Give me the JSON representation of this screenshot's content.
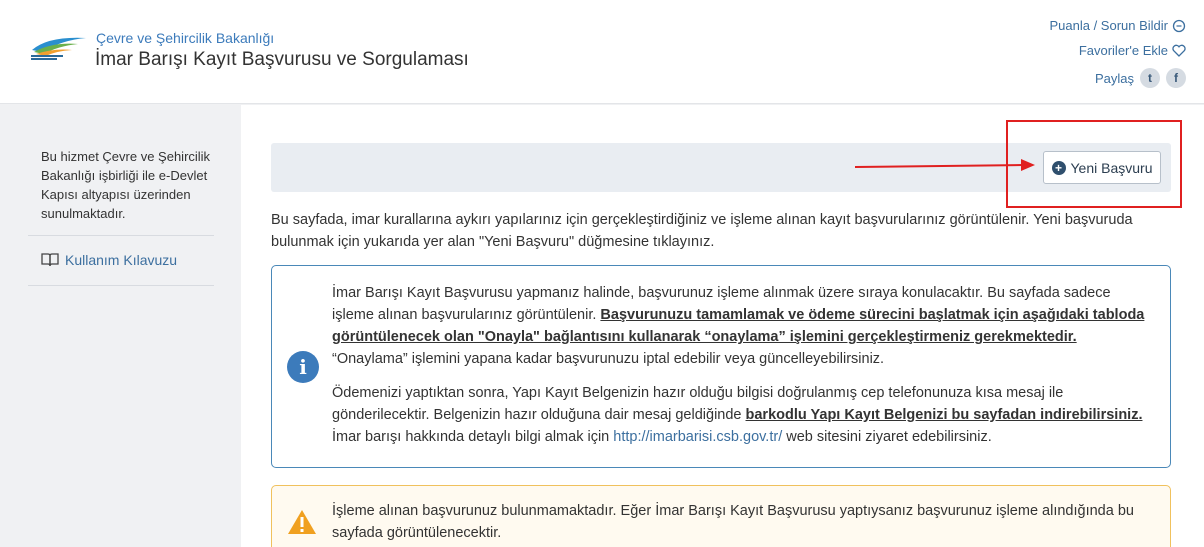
{
  "header": {
    "ministry": "Çevre ve Şehircilik Bakanlığı",
    "title": "İmar Barışı Kayıt Başvurusu ve Sorgulaması",
    "links": {
      "rate": "Puanla / Sorun Bildir",
      "favorites": "Favoriler'e Ekle",
      "share": "Paylaş"
    }
  },
  "sidebar": {
    "note": "Bu hizmet Çevre ve Şehircilik Bakanlığı işbirliği ile e-Devlet Kapısı altyapısı üzerinden sunulmaktadır.",
    "guide": "Kullanım Kılavuzu"
  },
  "toolbar": {
    "new_button": "Yeni Başvuru"
  },
  "content": {
    "intro": "Bu sayfada, imar kurallarına aykırı yapılarınız için gerçekleştirdiğiniz ve işleme alınan kayıt başvurularınız görüntülenir. Yeni başvuruda bulunmak için yukarıda yer alan \"Yeni Başvuru\" düğmesine tıklayınız.",
    "info": {
      "p1_a": "İmar Barışı Kayıt Başvurusu yapmanız halinde, başvurunuz işleme alınmak üzere sıraya konulacaktır. Bu sayfada sadece işleme alınan başvurularınız görüntülenir. ",
      "p1_bold": "Başvurunuzu tamamlamak ve ödeme sürecini başlatmak için aşağıdaki tabloda görüntülenecek olan \"Onayla\" bağlantısını kullanarak “onaylama” işlemini gerçekleştirmeniz gerekmektedir.",
      "p1_b": " “Onaylama” işlemini yapana kadar başvurunuzu iptal edebilir veya güncelleyebilirsiniz.",
      "p2_a": "Ödemenizi yaptıktan sonra, Yapı Kayıt Belgenizin hazır olduğu bilgisi doğrulanmış cep telefonunuza kısa mesaj ile gönderilecektir. Belgenizin hazır olduğuna dair mesaj geldiğinde ",
      "p2_bold": "barkodlu Yapı Kayıt Belgenizi bu sayfadan indirebilirsiniz.",
      "p2_b": " İmar barışı hakkında detaylı bilgi almak için ",
      "p2_link": "http://imarbarisi.csb.gov.tr/",
      "p2_c": " web sitesini ziyaret edebilirsiniz."
    },
    "warning": "İşleme alınan başvurunuz bulunmamaktadır. Eğer İmar Barışı Kayıt Başvurusu yaptıysanız başvurunuz işleme alındığında bu sayfada görüntülenecektir."
  },
  "colors": {
    "accent": "#3c7bbb",
    "annotation": "#e02020",
    "warning_border": "#f0c15d"
  }
}
